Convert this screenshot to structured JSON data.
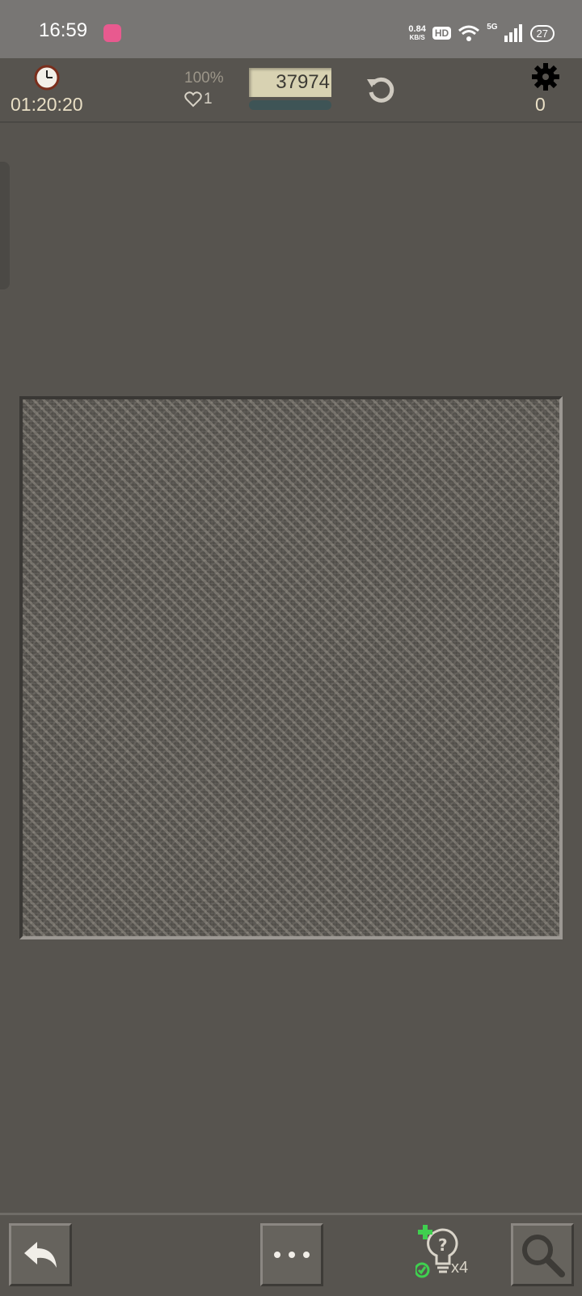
{
  "status_bar": {
    "time": "16:59",
    "net_speed": "0.84",
    "net_unit": "KB/S",
    "hd_label": "HD",
    "network_label": "5G",
    "weather_temp": "27"
  },
  "toolbar": {
    "timer": "01:20:20",
    "progress_percent": "100%",
    "lives": "1",
    "score": "37974",
    "settings_count": "0"
  },
  "bottom_bar": {
    "hint_count": "x4"
  },
  "icons": {
    "timer": "clock-icon",
    "lives": "heart-icon",
    "restart": "restart-icon",
    "settings": "gear-icon",
    "undo": "undo-arrow-icon",
    "more": "ellipsis-icon",
    "hint": "lightbulb-hint-icon",
    "search": "magnifier-icon"
  },
  "colors": {
    "background": "#57544f",
    "status_bar": "#787674",
    "text_light": "#e9dfc5",
    "score_box": "#d8d2b2",
    "hint_green": "#3fcf4f"
  }
}
